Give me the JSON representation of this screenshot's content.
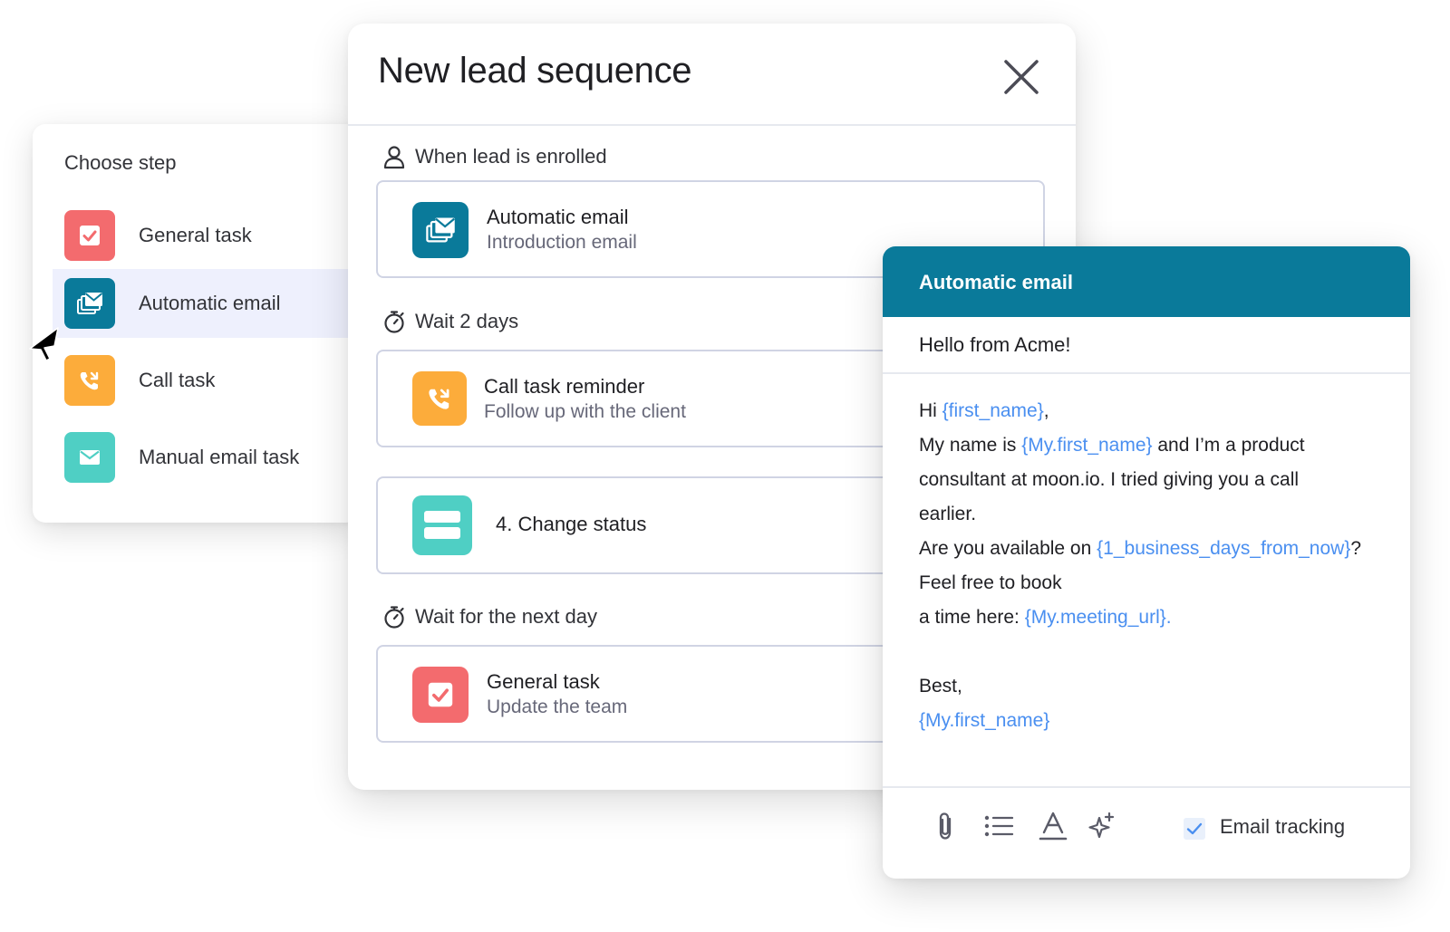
{
  "choose_step": {
    "title": "Choose step",
    "items": [
      {
        "label": "General task",
        "icon": "checkbox-icon",
        "color": "#f36b6e",
        "active": false
      },
      {
        "label": "Automatic email",
        "icon": "email-stack-icon",
        "color": "#0a7a9a",
        "active": true
      },
      {
        "label": "Call task",
        "icon": "phone-icon",
        "color": "#fcac3b",
        "active": false
      },
      {
        "label": "Manual email task",
        "icon": "envelope-icon",
        "color": "#4fcfc4",
        "active": false
      }
    ]
  },
  "sequence": {
    "title": "New lead sequence",
    "steps": [
      {
        "trigger": "When lead is enrolled",
        "trigger_icon": "person-icon",
        "title": "Automatic email",
        "subtitle": "Introduction email",
        "color": "#0a7a9a"
      },
      {
        "trigger": "Wait 2 days",
        "trigger_icon": "stopwatch-icon",
        "title": "Call task reminder",
        "subtitle": "Follow up with the client",
        "color": "#fcac3b"
      },
      {
        "title": "4. Change status",
        "color": "#4fcfc4"
      },
      {
        "trigger": "Wait for the next day",
        "trigger_icon": "stopwatch-icon",
        "title": "General task",
        "subtitle": "Update the team",
        "color": "#f36b6e"
      }
    ]
  },
  "email": {
    "header": "Automatic email",
    "subject": "Hello from Acme!",
    "body": {
      "greeting": "Hi ",
      "first_name_var": "{first_name}",
      "greeting_end": ",",
      "intro": "My name is ",
      "my_first_name_var": "{My.first_name}",
      "intro_end": " and I’m a product",
      "line3": "consultant at moon.io. I tried giving you a call",
      "line4": "earlier.",
      "avail": "Are you available on ",
      "days_var": "{1_business_days_from_now}",
      "avail_end": "?",
      "line6": "Feel free to book",
      "line7": "a time here: ",
      "meeting_var": "{My.meeting_url}.",
      "signoff": "Best,",
      "signature_var": "{My.first_name}"
    },
    "toolbar": {
      "icons": [
        "paperclip-icon",
        "bullet-list-icon",
        "text-color-icon",
        "ai-sparkle-icon"
      ],
      "tracking_label": "Email tracking",
      "tracking_checked": true
    }
  },
  "colors": {
    "accent": "#0a7a9a",
    "variable": "#4a8ff0",
    "active_row": "#eef0fd"
  }
}
